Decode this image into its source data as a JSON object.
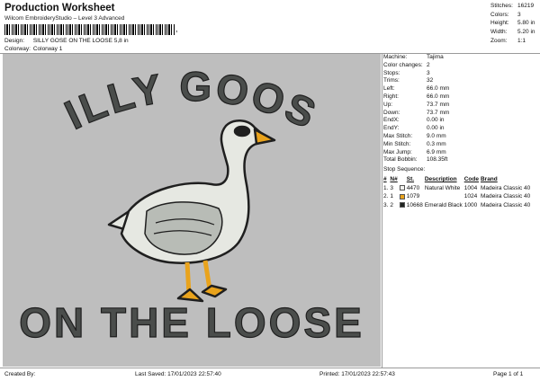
{
  "header": {
    "title": "Production Worksheet",
    "subtitle": "Wilcom EmbroideryStudio – Level 3 Advanced",
    "barcode_tail": ",",
    "design_label": "Design:",
    "design_value": "SILLY GOSE ON THE LOOSE 5,8 in",
    "colorway_label": "Colorway:",
    "colorway_value": "Colorway 1"
  },
  "top_stats": [
    {
      "label": "Stitches:",
      "value": "16219"
    },
    {
      "label": "Colors:",
      "value": "3"
    },
    {
      "label": "Height:",
      "value": "5.80 in"
    },
    {
      "label": "Width:",
      "value": "5.20 in"
    },
    {
      "label": "Zoom:",
      "value": "1:1"
    }
  ],
  "design_preview": {
    "top_text": "SILLY GOOSE",
    "bottom_text": "ON THE LOOSE",
    "text_color": "#4a4d4b",
    "goose_body": "#e6e8e2",
    "goose_outline": "#1f1f1f",
    "goose_shade": "#b8bcb6",
    "beak_color": "#e9a31c",
    "background": "#bebebe"
  },
  "machine_info": [
    {
      "label": "Machine:",
      "value": "Tajima"
    },
    {
      "label": "Color changes:",
      "value": "2"
    },
    {
      "label": "Stops:",
      "value": "3"
    },
    {
      "label": "Trims:",
      "value": "32"
    },
    {
      "label": "Left:",
      "value": "66.0 mm"
    },
    {
      "label": "Right:",
      "value": "66.0 mm"
    },
    {
      "label": "Up:",
      "value": "73.7 mm"
    },
    {
      "label": "Down:",
      "value": "73.7 mm"
    },
    {
      "label": "EndX:",
      "value": "0.00 in"
    },
    {
      "label": "EndY:",
      "value": "0.00 in"
    },
    {
      "label": "Max Stitch:",
      "value": "9.0 mm"
    },
    {
      "label": "Min Stitch:",
      "value": "0.3 mm"
    },
    {
      "label": "Max Jump:",
      "value": "6.9 mm"
    },
    {
      "label": "Total Bobbin:",
      "value": "108.35ft"
    }
  ],
  "stop_sequence": {
    "title": "Stop Sequence:",
    "headers": [
      "#",
      "N#",
      "",
      "St.",
      "Description",
      "Code",
      "Brand"
    ],
    "rows": [
      {
        "num": "1.",
        "n": "3",
        "color": "#f2f2ee",
        "st": "4470",
        "desc": "Natural White",
        "code": "1004",
        "brand": "Madeira Classic 40"
      },
      {
        "num": "2.",
        "n": "1",
        "color": "#e9a31c",
        "st": "1079",
        "desc": "",
        "code": "1024",
        "brand": "Madeira Classic 40"
      },
      {
        "num": "3.",
        "n": "2",
        "color": "#1f2421",
        "st": "10668",
        "desc": "Emerald Black",
        "code": "1000",
        "brand": "Madeira Classic 40"
      }
    ]
  },
  "footer": {
    "created_by": "Created By:",
    "last_saved": "Last Saved: 17/01/2023 22:57:40",
    "printed": "Printed: 17/01/2023 22:57:43",
    "page": "Page 1 of 1"
  }
}
